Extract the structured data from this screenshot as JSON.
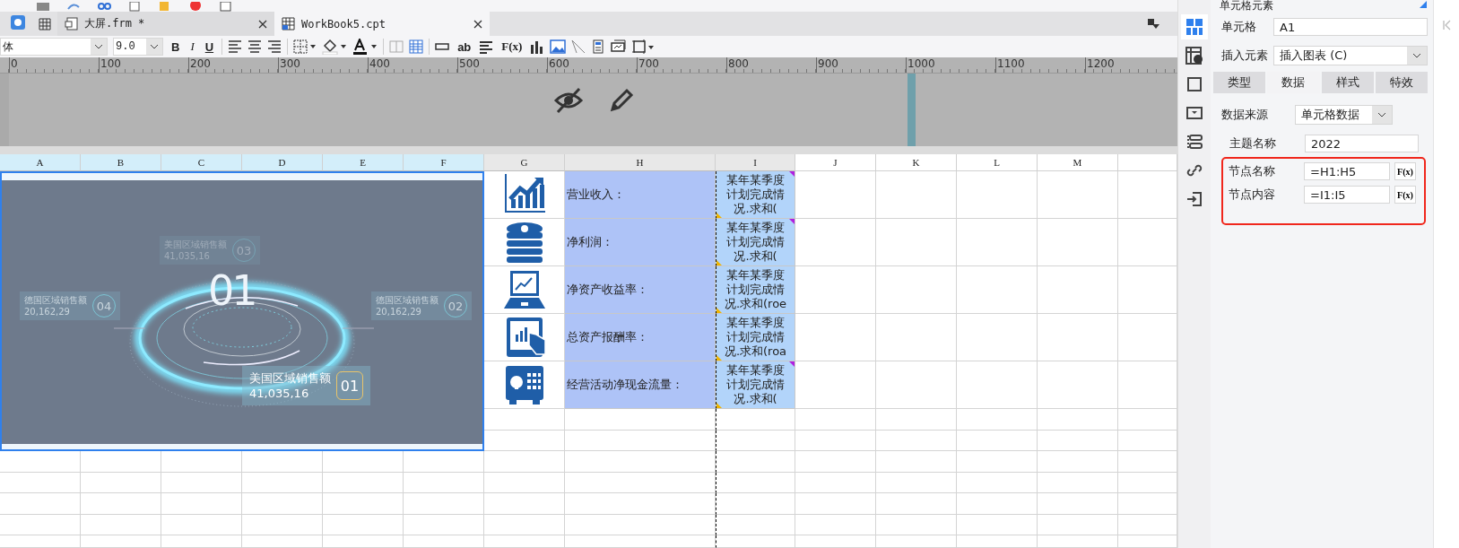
{
  "file_tabs": [
    {
      "label": "大屏.frm *",
      "selected": false
    },
    {
      "label": "WorkBook5.cpt",
      "selected": true
    }
  ],
  "format_toolbar": {
    "font": "体",
    "size": "9.0",
    "bold": "B",
    "italic": "I",
    "underline": "U",
    "text_tool": "ab",
    "formula": "F(x)"
  },
  "ruler": [
    "0",
    "100",
    "200",
    "300",
    "400",
    "500",
    "600",
    "700",
    "800",
    "900",
    "1000",
    "1100",
    "1200"
  ],
  "columns": [
    {
      "label": "A",
      "selected": true,
      "used": true
    },
    {
      "label": "B",
      "selected": true,
      "used": true
    },
    {
      "label": "C",
      "selected": true,
      "used": true
    },
    {
      "label": "D",
      "selected": true,
      "used": true
    },
    {
      "label": "E",
      "selected": true,
      "used": true
    },
    {
      "label": "F",
      "selected": true,
      "used": true
    },
    {
      "label": "G",
      "selected": false,
      "used": true
    },
    {
      "label": "H",
      "selected": false,
      "used": true
    },
    {
      "label": "I",
      "selected": false,
      "used": true
    },
    {
      "label": "J",
      "selected": false,
      "used": false
    },
    {
      "label": "K",
      "selected": false,
      "used": false
    },
    {
      "label": "L",
      "selected": false,
      "used": false
    },
    {
      "label": "M",
      "selected": false,
      "used": false
    }
  ],
  "chart_preview": {
    "big_number": "01",
    "labels": [
      {
        "title": "美国区域销售额",
        "value": "41,035,16",
        "index": "03",
        "faded": true,
        "highlighted": false
      },
      {
        "title": "德国区域销售额",
        "value": "20,162,29",
        "index": "04",
        "faded": false,
        "highlighted": false
      },
      {
        "title": "德国区域销售额",
        "value": "20,162,29",
        "index": "02",
        "faded": false,
        "highlighted": false
      },
      {
        "title": "美国区域销售额",
        "value": "41,035,16",
        "index": "01",
        "faded": false,
        "highlighted": true
      }
    ]
  },
  "rows": [
    {
      "name": "营业收入：",
      "content_lines": [
        "某年某季度",
        "计划完成情",
        "况.求和("
      ],
      "flagged": true
    },
    {
      "name": "净利润：",
      "content_lines": [
        "某年某季度",
        "计划完成情",
        "况.求和("
      ],
      "flagged": true
    },
    {
      "name": "净资产收益率：",
      "content_lines": [
        "某年某季度",
        "计划完成情",
        "况.求和(roe"
      ],
      "flagged": false
    },
    {
      "name": "总资产报酬率：",
      "content_lines": [
        "某年某季度",
        "计划完成情",
        "况.求和(roa"
      ],
      "flagged": false
    },
    {
      "name": "经营活动净现金流量：",
      "content_lines": [
        "某年某季度",
        "计划完成情",
        "况.求和("
      ],
      "flagged": true
    }
  ],
  "side_icons": [
    {
      "selected": true
    },
    {
      "selected": false
    },
    {
      "selected": false
    },
    {
      "selected": false
    },
    {
      "selected": false
    },
    {
      "selected": false
    },
    {
      "selected": false
    }
  ],
  "panel": {
    "title": "单元格元素",
    "cell": {
      "label": "单元格",
      "value": "A1"
    },
    "insert": {
      "label": "插入元素",
      "value": "插入图表 (C)"
    },
    "tabs": [
      {
        "label": "类型",
        "selected": false
      },
      {
        "label": "数据",
        "selected": true
      },
      {
        "label": "样式",
        "selected": false
      },
      {
        "label": "特效",
        "selected": false
      }
    ],
    "source": {
      "label": "数据来源",
      "value": "单元格数据"
    },
    "theme_name": {
      "label": "主题名称",
      "value": "2022"
    },
    "nodes": [
      {
        "label": "节点名称",
        "value": "=H1:H5",
        "button": "F(x)"
      },
      {
        "label": "节点内容",
        "value": "=I1:I5",
        "button": "F(x)"
      }
    ]
  }
}
